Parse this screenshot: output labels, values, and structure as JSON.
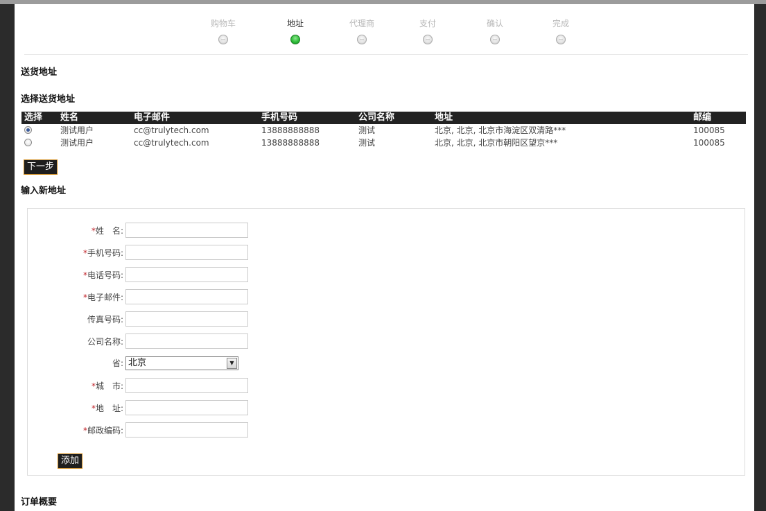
{
  "steps": [
    {
      "label": "购物车",
      "active": false
    },
    {
      "label": "地址",
      "active": true
    },
    {
      "label": "代理商",
      "active": false
    },
    {
      "label": "支付",
      "active": false
    },
    {
      "label": "确认",
      "active": false
    },
    {
      "label": "完成",
      "active": false
    }
  ],
  "sections": {
    "delivery_address": "送货地址",
    "select_address": "选择送货地址",
    "new_address": "输入新地址",
    "order_summary": "订单概要"
  },
  "address_table": {
    "headers": [
      "选择",
      "姓名",
      "电子邮件",
      "手机号码",
      "公司名称",
      "地址",
      "邮编"
    ],
    "rows": [
      {
        "selected": true,
        "name": "测试用户",
        "email": "cc@trulytech.com",
        "mobile": "13888888888",
        "company": "测试",
        "address": "北京, 北京, 北京市海淀区双清路***",
        "zip": "100085"
      },
      {
        "selected": false,
        "name": "测试用户",
        "email": "cc@trulytech.com",
        "mobile": "13888888888",
        "company": "测试",
        "address": "北京, 北京, 北京市朝阳区望京***",
        "zip": "100085"
      }
    ],
    "next_label": "下一步"
  },
  "form": {
    "required_mark": "*",
    "fields": {
      "name": "姓　名:",
      "mobile": "手机号码:",
      "phone": "电话号码:",
      "email": "电子邮件:",
      "fax": "传真号码:",
      "company": "公司名称:",
      "province": "省:",
      "city": "城　市:",
      "address": "地　址:",
      "zip": "邮政编码:"
    },
    "province_value": "北京",
    "add_label": "添加"
  },
  "colors": {
    "active_step": "#2fbf3a",
    "button_border": "#d08a1a",
    "required": "#c0252b",
    "header_bg": "#222222"
  }
}
